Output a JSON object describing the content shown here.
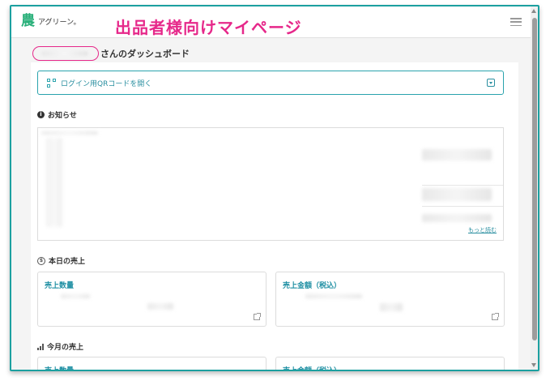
{
  "header": {
    "logo_mark": "農",
    "logo_text": "アグリーン。",
    "overlay_title": "出品者様向けマイページ"
  },
  "dashboard": {
    "title_suffix": "さんのダッシュボード"
  },
  "qr": {
    "label": "ログイン用QRコードを開く"
  },
  "news": {
    "title": "お知らせ",
    "more_label": "もっと読む"
  },
  "sales_today": {
    "title": "本日の売上",
    "quantity_label": "売上数量",
    "amount_label": "売上金額（税込）"
  },
  "sales_month": {
    "title": "今月の売上",
    "quantity_label": "売上数量",
    "amount_label": "売上金額（税込）"
  },
  "colors": {
    "accent": "#1f8fa3",
    "highlight": "#e6288a",
    "brand": "#2ab07a"
  }
}
